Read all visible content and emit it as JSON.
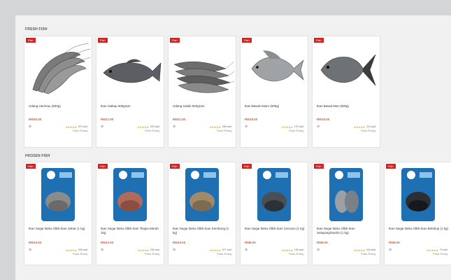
{
  "sections": {
    "fresh": {
      "title": "FRESH FISH",
      "cards": [
        {
          "tag": "Fish",
          "name": "Udang Harimau (500g)",
          "price": "RM30.00",
          "sold": "970 sold",
          "location": "Pulau Pinang",
          "icon": "prawn-image"
        },
        {
          "tag": "Fish",
          "name": "Ikan Siakap 500gram",
          "price": "RM17.50",
          "sold": "422 sold",
          "location": "Pulau Pinang",
          "icon": "seabass-image"
        },
        {
          "tag": "Fish",
          "name": "Udang Galah 500gram",
          "price": "RM11.50",
          "sold": "289 sold",
          "location": "Pulau Pinang",
          "icon": "prawns-image"
        },
        {
          "tag": "Fish",
          "name": "Ikan Bawal Hitam (500g)",
          "price": "RM18.00",
          "sold": "197 sold",
          "location": "Pulau Pinang",
          "icon": "black-pomfret-image"
        },
        {
          "tag": "Fish",
          "name": "Ikan Bawal Mas (500g)",
          "price": "RM15.00",
          "sold": "113 sold",
          "location": "Pulau Pinang",
          "icon": "golden-pomfret-image"
        }
      ]
    },
    "frozen": {
      "title": "FROZEN FISH",
      "cards": [
        {
          "tag": "Fish",
          "name": "Ikan Segar Beku Olkib Ikan Sebar (1 kg)",
          "price": "RM15.00",
          "sold": "203 sold",
          "location": "Pulau Pinang",
          "icon": "frozen-fish-pack-image"
        },
        {
          "tag": "Fish",
          "name": "Ikan Segar Beku Olkib Ikan Tilapia Merah 1kg",
          "price": "RM12.50",
          "sold": "200 sold",
          "location": "Pulau Pinang",
          "icon": "frozen-fish-pack-image"
        },
        {
          "tag": "Fish",
          "name": "Ikan Segar Beku Olkib Ikan Kembung (1 kg)",
          "price": "RM10.00",
          "sold": "377 sold",
          "location": "Pulau Pinang",
          "icon": "frozen-fish-pack-image"
        },
        {
          "tag": "Fish",
          "name": "Ikan Segar Beku Olkib Ikan Cencaru (1 kg)",
          "price": "RM8.00",
          "sold": "153 sold",
          "location": "Pulau Pinang",
          "icon": "frozen-fish-pack-image"
        },
        {
          "tag": "Fish",
          "name": "Ikan Segar Beku Olkib Ikan Selayang/Sardin (1 kg)",
          "price": "RM8.00",
          "sold": "118 sold",
          "location": "Pulau Pinang",
          "icon": "frozen-fish-pack-image"
        },
        {
          "tag": "Fish",
          "name": "Ikan Segar Beku Olkib Ikan Belahup (1 kg)",
          "price": "RM8.00",
          "sold": "79 sold",
          "location": "Pulau Pinang",
          "icon": "frozen-fish-pack-image"
        }
      ]
    }
  },
  "common": {
    "stars": "★★★★★",
    "cart_icon": "cart-icon"
  },
  "colors": {
    "tag": "#c62828",
    "price": "#e25b2a",
    "stars": "#e6a817",
    "pack": "#1f6fb3"
  }
}
